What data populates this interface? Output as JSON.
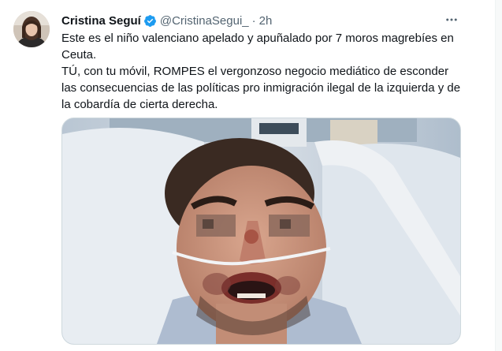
{
  "tweet": {
    "author_name": "Cristina Seguí",
    "handle": "@CristinaSegui_",
    "separator": "·",
    "time": "2h",
    "text_line1": "Este es el niño valenciano apelado y apuñalado por 7 moros magrebíes en Ceuta.",
    "text_line2": "TÚ, con tu móvil, ROMPES el vergonzoso negocio mediático de esconder las consecuencias de las políticas pro inmigración ilegal de la izquierda y de la cobardía de cierta derecha."
  },
  "icons": {
    "verified": "verified-badge-icon",
    "more": "more-options-icon"
  },
  "colors": {
    "verified_blue": "#1d9bf0",
    "secondary_text": "#536471"
  }
}
